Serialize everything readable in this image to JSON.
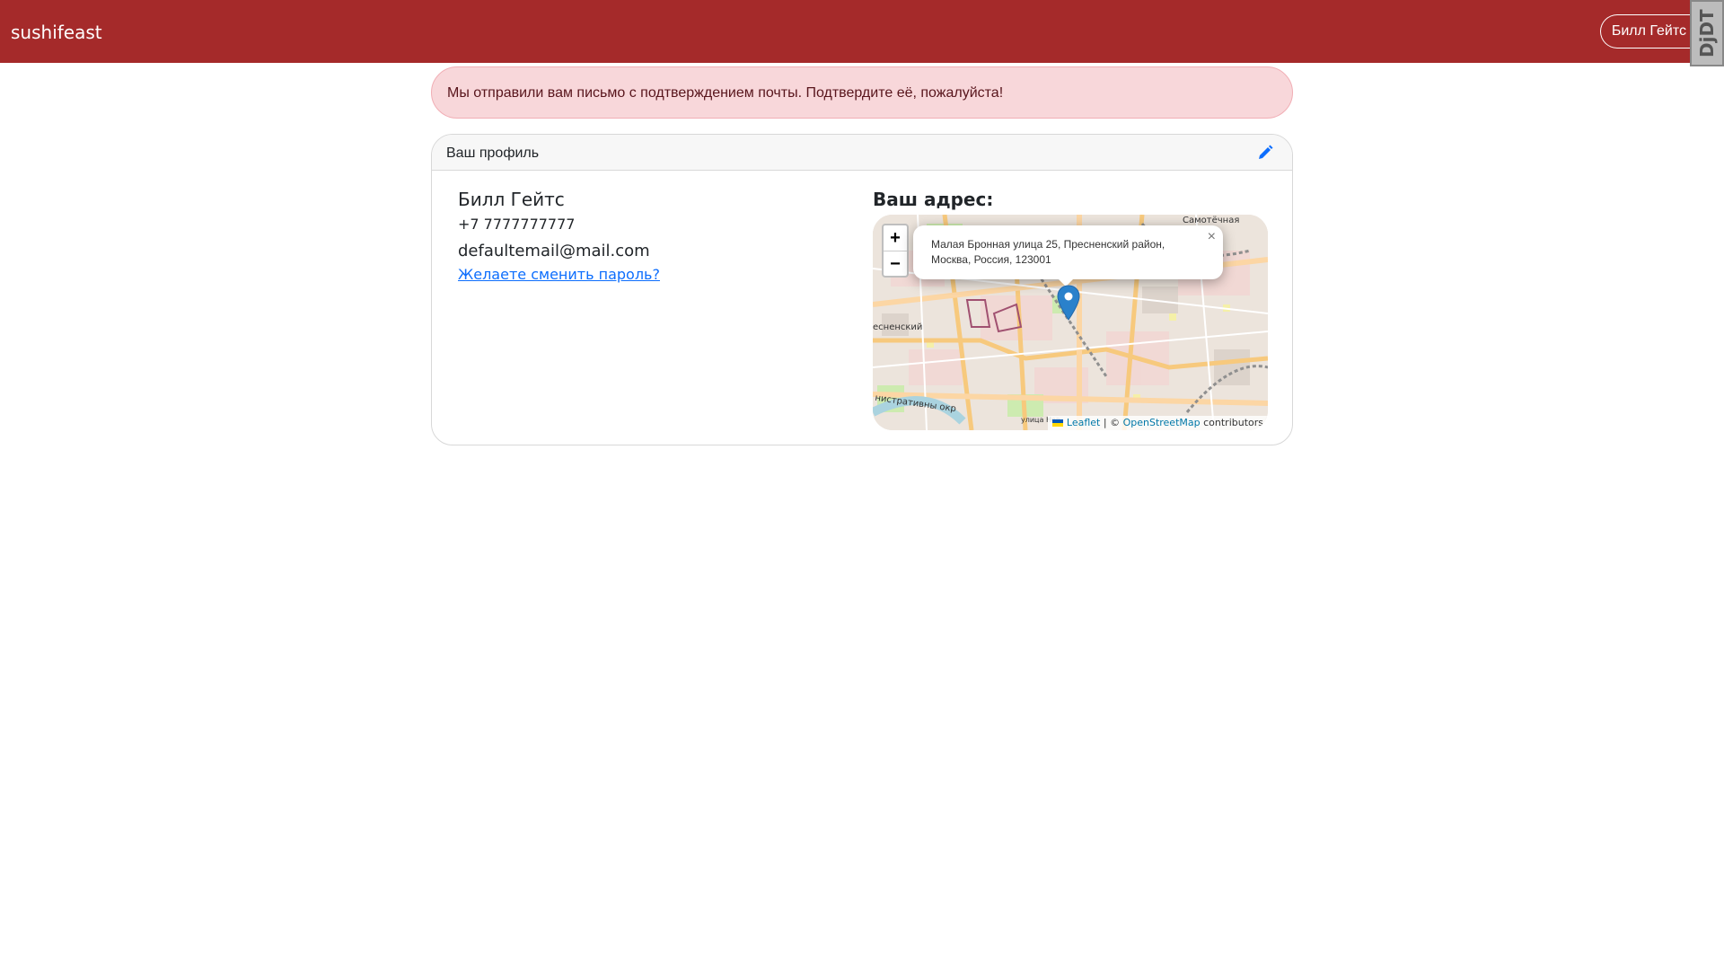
{
  "navbar": {
    "brand": "sushifeast",
    "user_button": "Билл Гейтс",
    "debug_toolbar": "DjDT"
  },
  "alert": {
    "message": "Мы отправили вам письмо с подтверждением почты. Подтвердите её, пожалуйста!"
  },
  "profile": {
    "header": "Ваш профиль",
    "edit_icon": "pencil-icon",
    "name": "Билл Гейтс",
    "phone": "+7 7777777777",
    "email": "defaultemail@mail.com",
    "change_password_link": "Желаете сменить пароль?",
    "address_title": "Ваш адрес:"
  },
  "map": {
    "zoom_in": "+",
    "zoom_out": "−",
    "popup_text": "Малая Бронная улица 25, Пресненский район, Москва, Россия, 123001",
    "popup_close": "×",
    "label_top": "Самотёчная",
    "label_left": "есненский",
    "label_bottom": "улица Нов",
    "label_river": "нистративны окр",
    "attribution_leaflet": "Leaflet",
    "attribution_sep": " | © ",
    "attribution_osm": "OpenStreetMap",
    "attribution_tail": " contributors"
  },
  "colors": {
    "navbar": "#a52a2a",
    "alert_bg": "#f8d7da",
    "link": "#0d6efd",
    "marker": "#2a81cb"
  }
}
